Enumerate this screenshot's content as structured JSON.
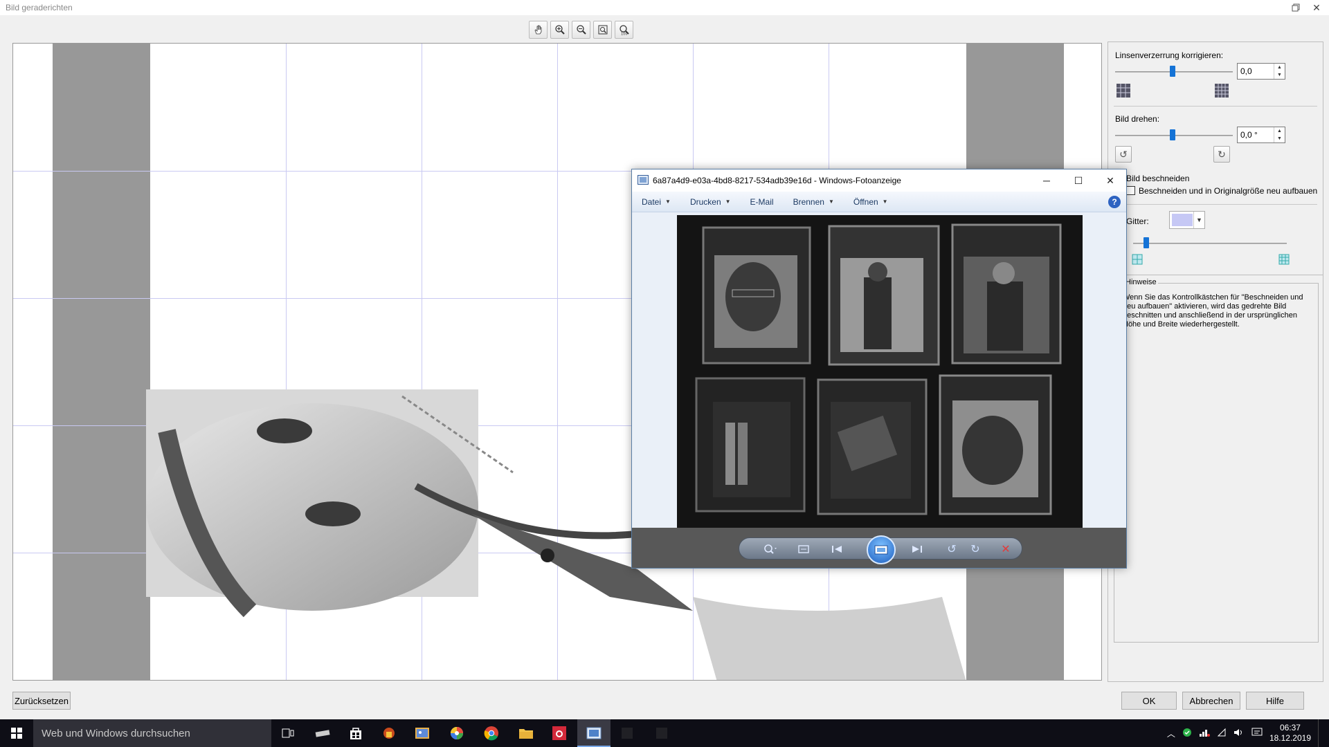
{
  "dialog": {
    "title": "Bild geraderichten",
    "toolbar": {
      "icons": [
        "hand-icon",
        "zoom-in-icon",
        "zoom-out-icon",
        "fit-icon",
        "actual-size-icon"
      ]
    }
  },
  "panel": {
    "lens_label": "Linsenverzerrung korrigieren:",
    "lens_value": "0,0",
    "rotate_label": "Bild drehen:",
    "rotate_value": "0,0 °",
    "crop_label": "Bild beschneiden",
    "crop_rebuild_label": "Beschneiden und in Originalgröße neu aufbauen",
    "grid_label": "Gitter:",
    "grid_color": "#c6c8f5",
    "hints_title": "Hinweise",
    "hints_text": "Wenn Sie das Kontrollkästchen für \"Beschneiden und neu aufbauen\" aktivieren, wird das gedrehte Bild beschnitten und anschließend in der ursprünglichen Höhe und Breite wiederhergestellt."
  },
  "buttons": {
    "reset": "Zurücksetzen",
    "ok": "OK",
    "cancel": "Abbrechen",
    "help": "Hilfe"
  },
  "viewer": {
    "title": "6a87a4d9-e03a-4bd8-8217-534adb39e16d - Windows-Fotoanzeige",
    "menu": {
      "file": "Datei",
      "print": "Drucken",
      "email": "E-Mail",
      "burn": "Brennen",
      "open": "Öffnen"
    }
  },
  "taskbar": {
    "search_placeholder": "Web und Windows durchsuchen",
    "time": "06:37",
    "date": "18.12.2019"
  }
}
